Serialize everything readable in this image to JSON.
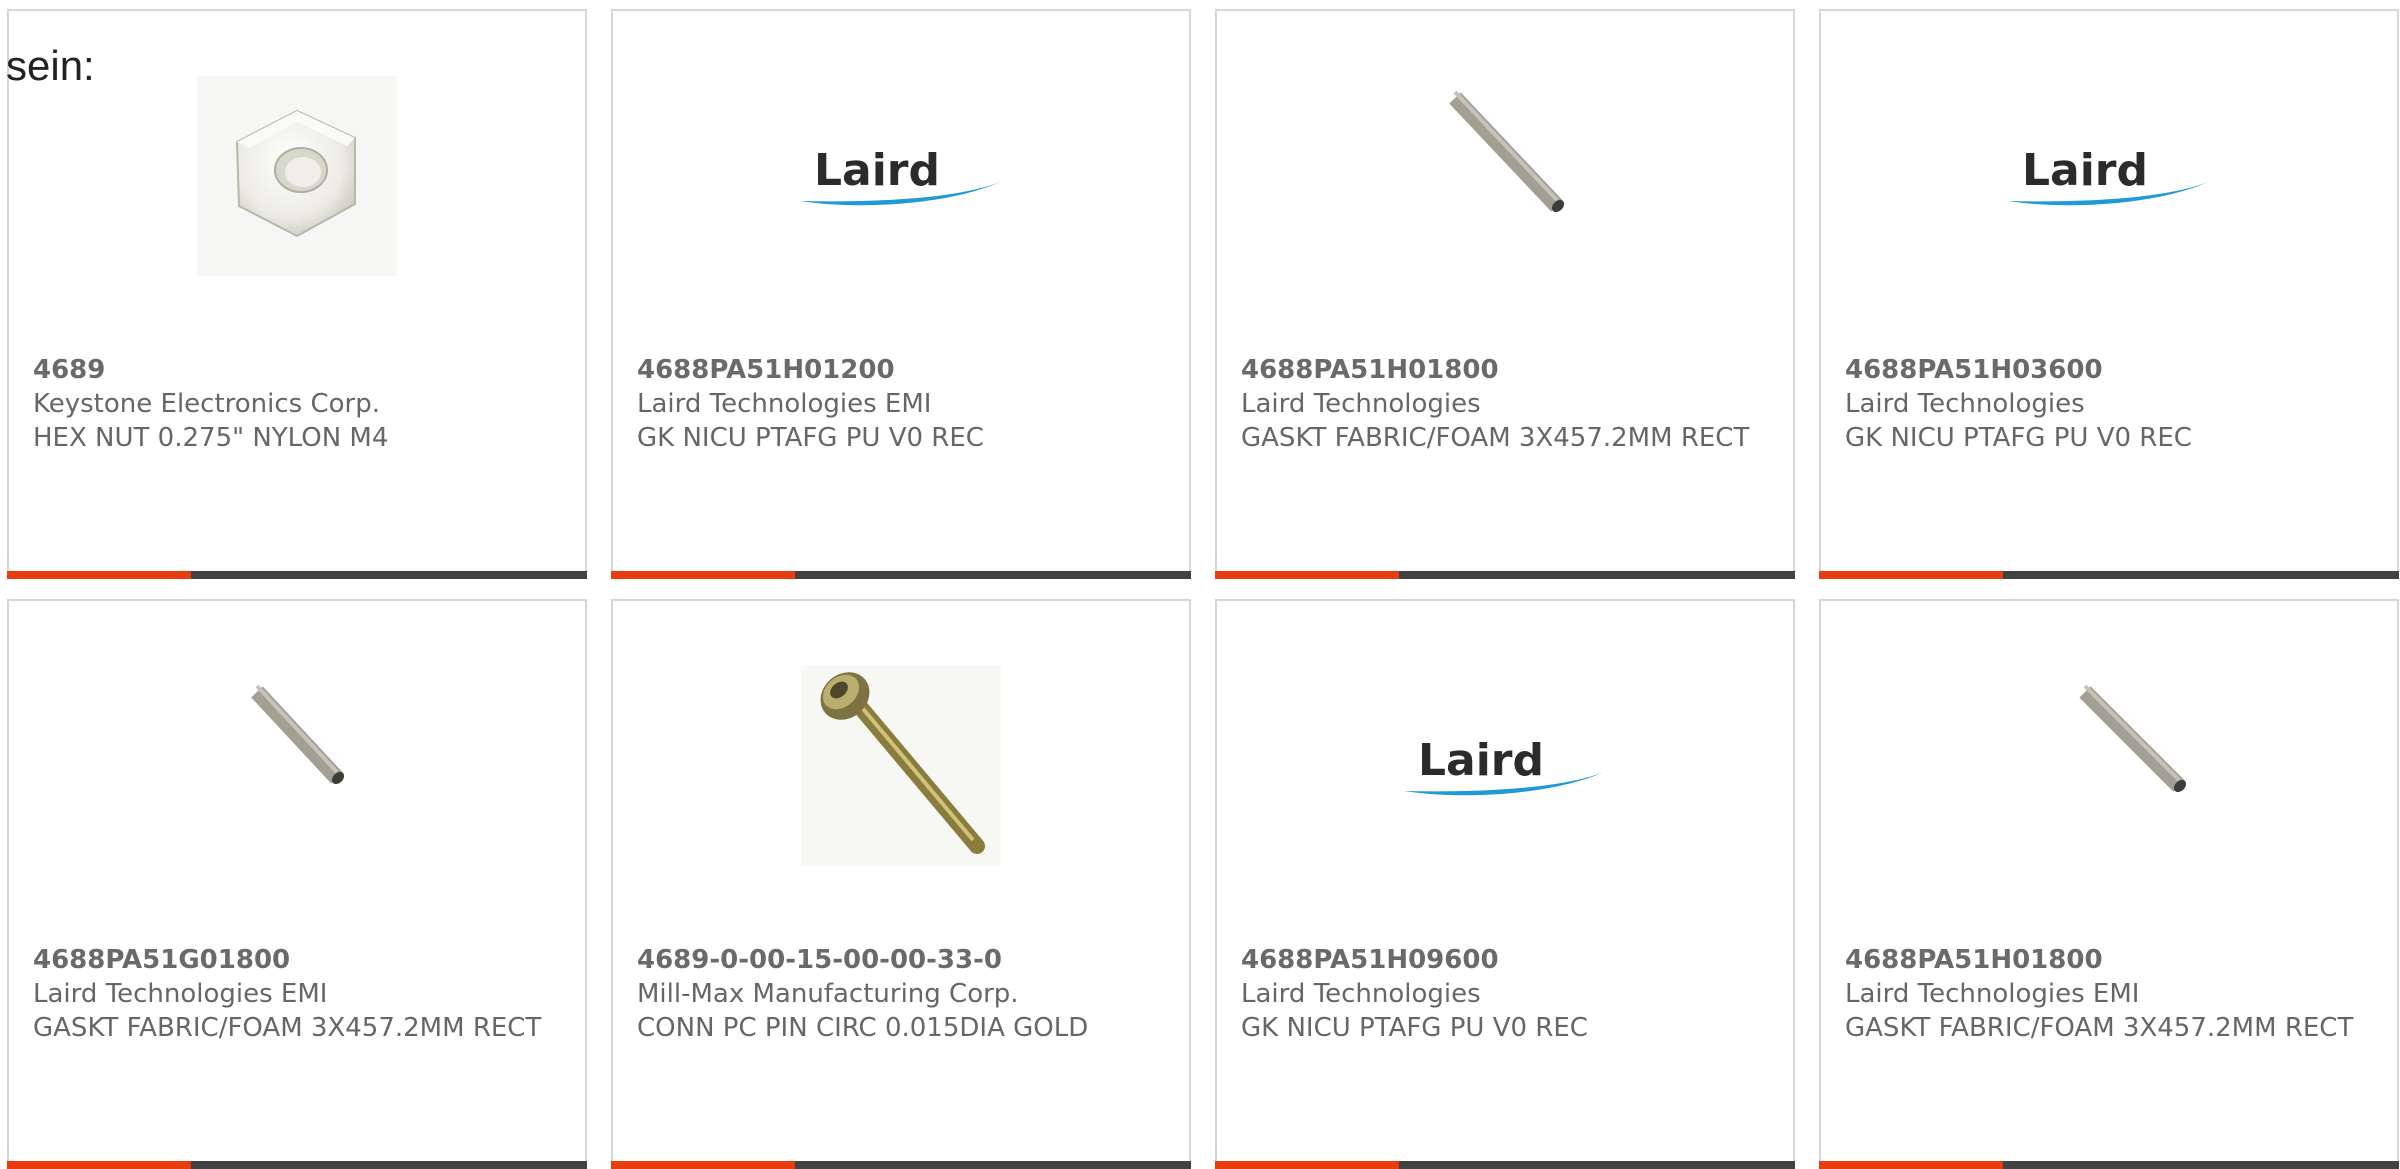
{
  "intro_text": "sein:",
  "colors": {
    "accent": "#e83d0f",
    "bar": "#424242",
    "text": "#666666",
    "border": "#d6d6d6",
    "laird_swoosh": "#1f9ad6"
  },
  "logo_text": "Laird",
  "products": [
    {
      "part_number": "4689",
      "manufacturer": "Keystone Electronics Corp.",
      "description": "HEX NUT 0.275\" NYLON M4",
      "image": "hex-nut-photo"
    },
    {
      "part_number": "4688PA51H01200",
      "manufacturer": "Laird Technologies EMI",
      "description": "GK NICU PTAFG PU V0 REC",
      "image": "laird-logo"
    },
    {
      "part_number": "4688PA51H01800",
      "manufacturer": "Laird Technologies",
      "description": "GASKT FABRIC/FOAM 3X457.2MM RECT",
      "image": "gasket-strip-photo"
    },
    {
      "part_number": "4688PA51H03600",
      "manufacturer": "Laird Technologies",
      "description": "GK NICU PTAFG PU V0 REC",
      "image": "laird-logo"
    },
    {
      "part_number": "4688PA51G01800",
      "manufacturer": "Laird Technologies EMI",
      "description": "GASKT FABRIC/FOAM 3X457.2MM RECT",
      "image": "gasket-strip-photo"
    },
    {
      "part_number": "4689-0-00-15-00-00-33-0",
      "manufacturer": "Mill-Max Manufacturing Corp.",
      "description": "CONN PC PIN CIRC 0.015DIA GOLD",
      "image": "pin-photo"
    },
    {
      "part_number": "4688PA51H09600",
      "manufacturer": "Laird Technologies",
      "description": "GK NICU PTAFG PU V0 REC",
      "image": "laird-logo"
    },
    {
      "part_number": "4688PA51H01800",
      "manufacturer": "Laird Technologies EMI",
      "description": "GASKT FABRIC/FOAM 3X457.2MM RECT",
      "image": "gasket-strip-photo"
    }
  ]
}
